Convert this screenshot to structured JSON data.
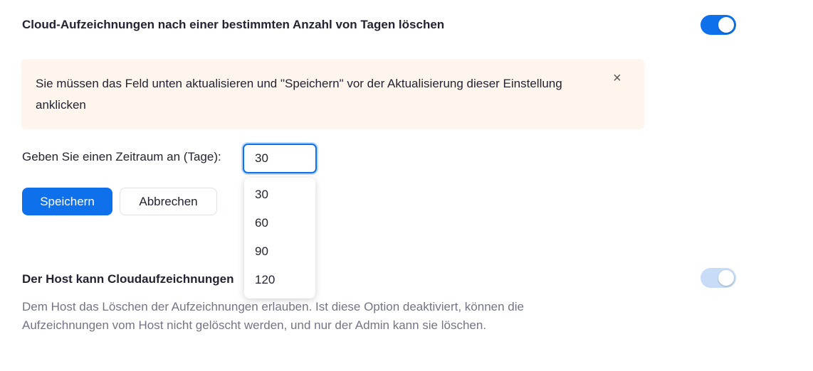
{
  "settings": [
    {
      "title": "Cloud-Aufzeichnungen nach einer bestimmten Anzahl von Tagen löschen",
      "enabled": true
    },
    {
      "title": "Der Host kann Cloudaufzeichnungen",
      "description": "Dem Host das Löschen der Aufzeichnungen erlauben. Ist diese Option deaktiviert, können die Aufzeichnungen vom Host nicht gelöscht werden, und nur der Admin kann sie löschen.",
      "enabled": true,
      "disabled_appearance": true
    }
  ],
  "alert": {
    "text": "Sie müssen das Feld unten aktualisieren und \"Speichern\" vor der Aktualisierung dieser Einstellung anklicken",
    "close_symbol": "×",
    "close_icon": "close-icon"
  },
  "period": {
    "label": "Geben Sie einen Zeitraum an (Tage):",
    "value": "30",
    "options": [
      "30",
      "60",
      "90",
      "120"
    ]
  },
  "buttons": {
    "save": "Speichern",
    "cancel": "Abbrechen"
  },
  "colors": {
    "accent": "#0e71eb",
    "alert_background": "#fef5ec",
    "toggle_disabled": "#c8dcf7",
    "description_text": "#747487"
  }
}
